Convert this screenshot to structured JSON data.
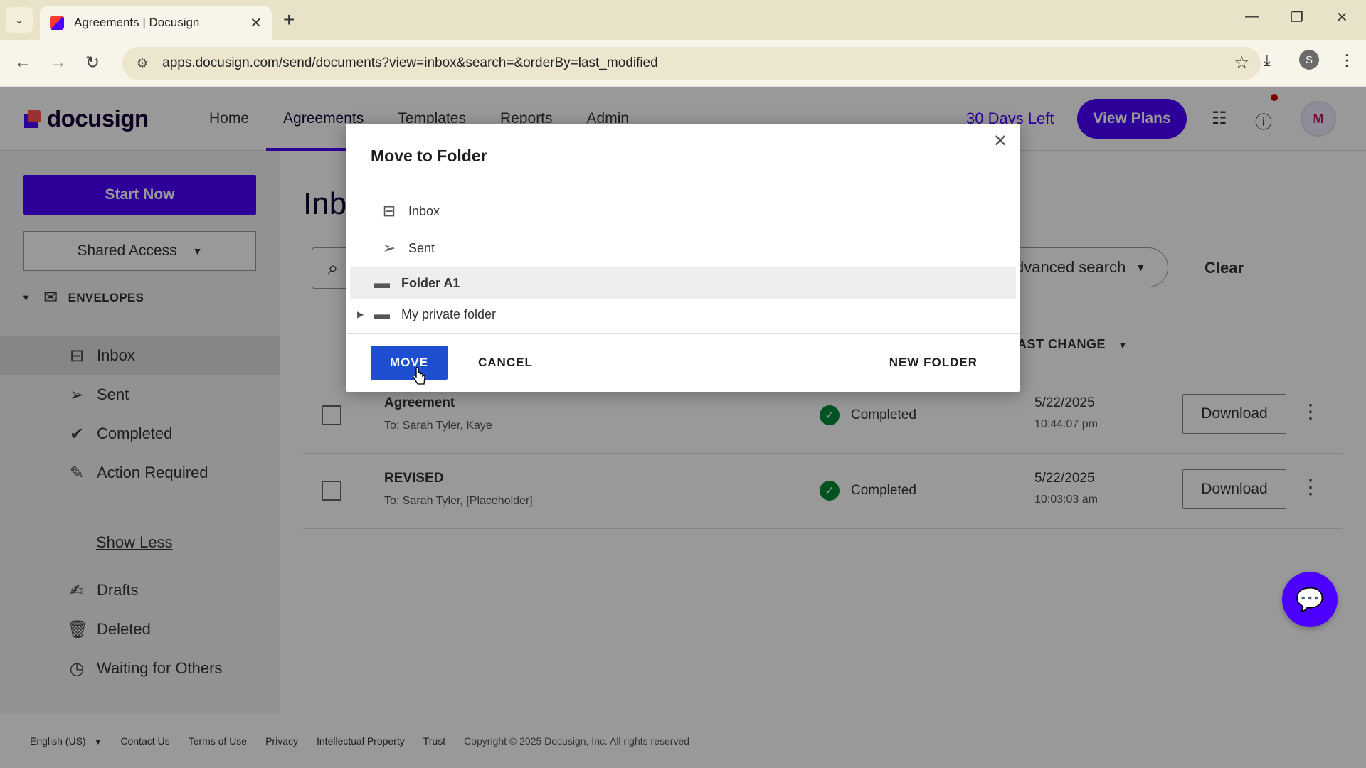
{
  "browser": {
    "tab_title": "Agreements | Docusign",
    "url": "apps.docusign.com/send/documents?view=inbox&search=&orderBy=last_modified",
    "profile_initial": "S"
  },
  "header": {
    "logo": "docusign",
    "nav": [
      "Home",
      "Agreements",
      "Templates",
      "Reports",
      "Admin"
    ],
    "active_nav": "Agreements",
    "trial_text": "30 Days Left",
    "view_plans": "View Plans",
    "avatar_initials": "M"
  },
  "sidebar": {
    "start_now": "Start Now",
    "shared_access": "Shared Access",
    "envelopes_label": "ENVELOPES",
    "items": [
      {
        "label": "Inbox",
        "icon": "inbox-icon"
      },
      {
        "label": "Sent",
        "icon": "send-icon"
      },
      {
        "label": "Completed",
        "icon": "check-circle-icon"
      },
      {
        "label": "Action Required",
        "icon": "pen-icon"
      },
      {
        "label": "Drafts",
        "icon": "draft-icon"
      },
      {
        "label": "Deleted",
        "icon": "trash-icon"
      },
      {
        "label": "Waiting for Others",
        "icon": "clock-icon"
      }
    ],
    "show_less": "Show Less"
  },
  "main": {
    "title": "Inb",
    "advanced_search": "dvanced search",
    "clear": "Clear",
    "col_last_change": "AST CHANGE",
    "rows": [
      {
        "subject": "Agreement",
        "to": "To: Sarah Tyler, Kaye",
        "status": "Completed",
        "date": "5/22/2025",
        "time": "10:44:07 pm",
        "action": "Download"
      },
      {
        "subject": "REVISED",
        "to": "To: Sarah Tyler, [Placeholder]",
        "status": "Completed",
        "date": "5/22/2025",
        "time": "10:03:03 am",
        "action": "Download"
      }
    ]
  },
  "modal": {
    "title": "Move to Folder",
    "folders": [
      {
        "label": "Inbox",
        "icon": "inbox-icon"
      },
      {
        "label": "Sent",
        "icon": "send-icon"
      },
      {
        "label": "Folder A1",
        "icon": "folder-icon",
        "selected": true
      },
      {
        "label": "My private folder",
        "icon": "folder-icon",
        "expandable": true
      }
    ],
    "move": "MOVE",
    "cancel": "CANCEL",
    "new_folder": "NEW FOLDER"
  },
  "footer": {
    "language": "English (US)",
    "links": [
      "Contact Us",
      "Terms of Use",
      "Privacy",
      "Intellectual Property",
      "Trust"
    ],
    "copyright": "Copyright © 2025 Docusign, Inc. All rights reserved"
  },
  "colors": {
    "brand": "#4c00ff",
    "move_button": "#1e4fd0",
    "completed": "#008938"
  }
}
